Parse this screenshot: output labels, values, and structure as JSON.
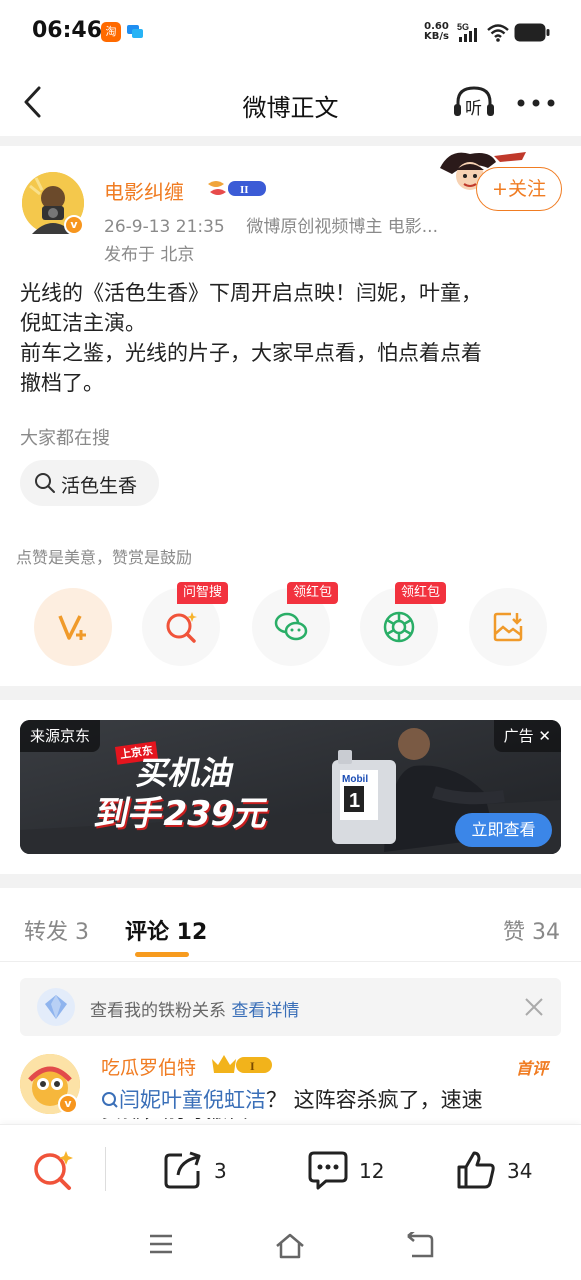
{
  "status_bar": {
    "time": "06:46",
    "app_icon_1": "淘",
    "net_speed_value": "0.60",
    "net_speed_unit": "KB/s",
    "network": "5G"
  },
  "nav": {
    "title": "微博正文",
    "listen_label": "听"
  },
  "post": {
    "author": "电影纠缠",
    "author_badge": "II",
    "verified_mark": "v",
    "time": "26-9-13 21:35",
    "source": "微博原创视频博主 电影...",
    "location": "发布于 北京",
    "follow_label": "+关注",
    "content_lines": [
      "光线的《活色生香》下周开启点映！闫妮，叶童，",
      "倪虹洁主演。",
      "前车之鉴，光线的片子，大家早点看，怕点着点着",
      "撤档了。"
    ],
    "search_hint": "大家都在搜",
    "search_chip": "活色生香",
    "reward_hint": "点赞是美意，赞赏是鼓励",
    "actions": [
      {
        "icon": "v-plus-icon",
        "tag": ""
      },
      {
        "icon": "ask-search-icon",
        "tag": "问智搜"
      },
      {
        "icon": "wechat-icon",
        "tag": "领红包"
      },
      {
        "icon": "moments-icon",
        "tag": "领红包"
      },
      {
        "icon": "save-image-icon",
        "tag": ""
      }
    ]
  },
  "ad": {
    "source": "来源京东",
    "label": "广告",
    "brand_tag": "上京东",
    "headline_1": "买机油",
    "headline_2": "到手239元",
    "bottle_brand": "Mobil",
    "bottle_number": "1",
    "cta": "立即查看"
  },
  "tabs": {
    "repost": "转发 3",
    "comment": "评论 12",
    "like": "赞 34"
  },
  "fans_bar": {
    "text": "查看我的铁粉关系 ",
    "link": "查看详情"
  },
  "comment": {
    "name": "吃瓜罗伯特",
    "level_badge": "I",
    "first_tag": "首评",
    "verified_mark": "v",
    "topic": "闫妮叶童倪虹洁",
    "text": "？ 这阵容杀疯了，速速",
    "text_cut": "安排，别等撤档"
  },
  "action_bar": {
    "repost_count": "3",
    "comment_count": "12",
    "like_count": "34"
  },
  "colors": {
    "accent_orange": "#f07c22",
    "link_blue": "#3a6fb8",
    "tag_red": "#f2323e",
    "tab_underline": "#f79b1e"
  }
}
